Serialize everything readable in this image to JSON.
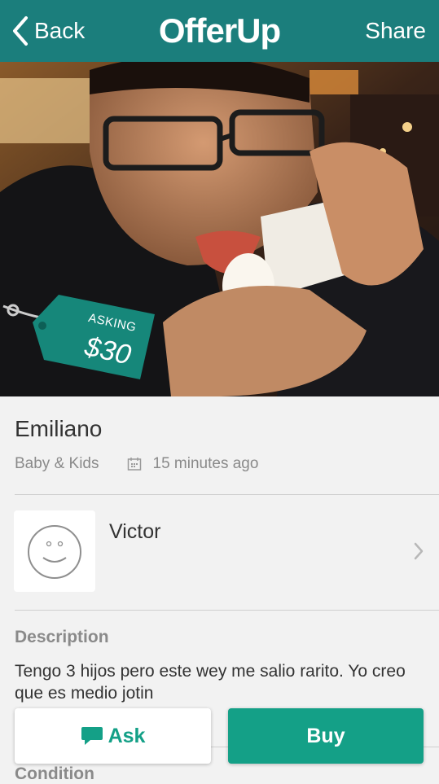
{
  "nav": {
    "back_label": "Back",
    "logo": "OfferUp",
    "share_label": "Share"
  },
  "listing": {
    "asking_label": "ASKING",
    "price": "$30",
    "title": "Emiliano",
    "category": "Baby & Kids",
    "posted": "15 minutes ago"
  },
  "seller": {
    "name": "Victor"
  },
  "description": {
    "heading": "Description",
    "text": "Tengo 3 hijos pero este wey me salio rarito. Yo creo que es medio jotin"
  },
  "condition": {
    "heading": "Condition"
  },
  "actions": {
    "ask_label": "Ask",
    "buy_label": "Buy"
  },
  "colors": {
    "nav": "#1b7e7c",
    "accent": "#14a087",
    "tag": "#16877a"
  },
  "icons": [
    "chevron-left-icon",
    "calendar-icon",
    "smiley-avatar-icon",
    "chevron-right-icon",
    "chat-bubble-icon"
  ]
}
